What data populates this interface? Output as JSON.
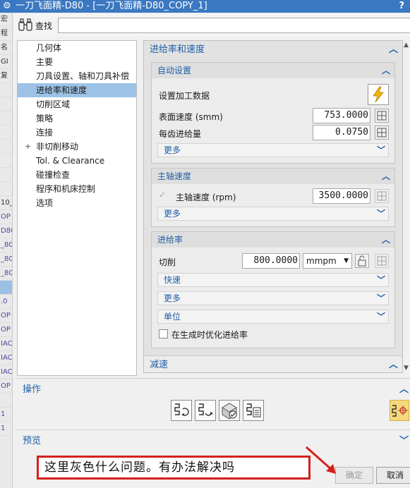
{
  "window": {
    "title": "一刀飞面精-D80 - [一刀飞面精-D80_COPY_1]",
    "help": "?"
  },
  "background_app": {
    "rows": [
      "宏",
      "程",
      "名",
      "GI",
      "复",
      "",
      "",
      "",
      "",
      "",
      "",
      "",
      "",
      "10_",
      "OP",
      "D80",
      "_80",
      "_80",
      "_80",
      "",
      ".0",
      "OP",
      "OP",
      "IAC",
      "IAC",
      "IAC",
      "OP",
      "",
      "1",
      "1"
    ]
  },
  "toolbar": {
    "find_label": "查找",
    "find_value": ""
  },
  "nav": {
    "items": [
      {
        "label": "几何体"
      },
      {
        "label": "主要"
      },
      {
        "label": "刀具设置、轴和刀具补偿"
      },
      {
        "label": "进给率和速度"
      },
      {
        "label": "切削区域"
      },
      {
        "label": "策略"
      },
      {
        "label": "连接"
      },
      {
        "label": "非切削移动",
        "expander": "+"
      },
      {
        "label": "Tol. & Clearance"
      },
      {
        "label": "碰撞检查"
      },
      {
        "label": "程序和机床控制"
      },
      {
        "label": "选项"
      }
    ],
    "selected_index": 3
  },
  "feeds": {
    "section_title": "进给率和速度",
    "auto": {
      "title": "自动设置",
      "set_data_label": "设置加工数据",
      "surface_speed_label": "表面速度 (smm)",
      "surface_speed_value": "753.0000",
      "feed_per_tooth_label": "每齿进给量",
      "feed_per_tooth_value": "0.0750",
      "more_label": "更多"
    },
    "spindle": {
      "title": "主轴速度",
      "spindle_label": "主轴速度 (rpm)",
      "spindle_value": "3500.0000",
      "spindle_checked": true,
      "more_label": "更多"
    },
    "feedrate": {
      "title": "进给率",
      "cut_label": "切削",
      "cut_value": "800.0000",
      "unit": "mmpm",
      "rapid_label": "快速",
      "more_label": "更多",
      "units_label": "单位",
      "optimize_label": "在生成时优化进给率",
      "optimize_checked": false
    },
    "decel_title": "减速"
  },
  "operations": {
    "title": "操作",
    "buttons": [
      "generate-icon",
      "replay-icon",
      "verify-icon",
      "list-icon"
    ]
  },
  "preview": {
    "title": "预览"
  },
  "footer": {
    "ok_label": "确定",
    "cancel_label": "取消"
  },
  "annotation": {
    "text": "这里灰色什么问题。有办法解决吗",
    "border_color": "#d61f1f"
  }
}
